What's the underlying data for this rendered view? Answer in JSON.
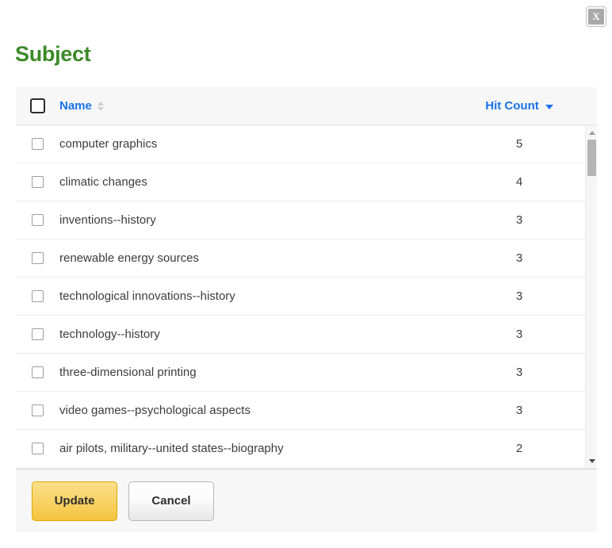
{
  "dialog": {
    "title": "Subject",
    "close_label": "X",
    "title_color": "#3c8a29"
  },
  "table": {
    "select_all_name": "select-all",
    "columns": [
      {
        "key": "name",
        "label": "Name",
        "sort_state": "none",
        "sort_icon": "sort-both-icon",
        "color": "#1a73e8"
      },
      {
        "key": "hit_count",
        "label": "Hit Count",
        "sort_state": "descending",
        "sort_icon": "sort-desc-icon",
        "color": "#1a73e8"
      }
    ],
    "rows": [
      {
        "name": "computer graphics",
        "hit_count": "5",
        "checked": false
      },
      {
        "name": "climatic changes",
        "hit_count": "4",
        "checked": false
      },
      {
        "name": "inventions--history",
        "hit_count": "3",
        "checked": false
      },
      {
        "name": "renewable energy sources",
        "hit_count": "3",
        "checked": false
      },
      {
        "name": "technological innovations--history",
        "hit_count": "3",
        "checked": false
      },
      {
        "name": "technology--history",
        "hit_count": "3",
        "checked": false
      },
      {
        "name": "three-dimensional printing",
        "hit_count": "3",
        "checked": false
      },
      {
        "name": "video games--psychological aspects",
        "hit_count": "3",
        "checked": false
      },
      {
        "name": "air pilots, military--united states--biography",
        "hit_count": "2",
        "checked": false
      }
    ]
  },
  "scrollbar": {
    "up_arrow": "scroll-up-arrow",
    "down_arrow": "scroll-down-arrow",
    "thumb": "scroll-thumb"
  },
  "footer": {
    "update_label": "Update",
    "cancel_label": "Cancel",
    "update_color": "#f6c33f"
  }
}
